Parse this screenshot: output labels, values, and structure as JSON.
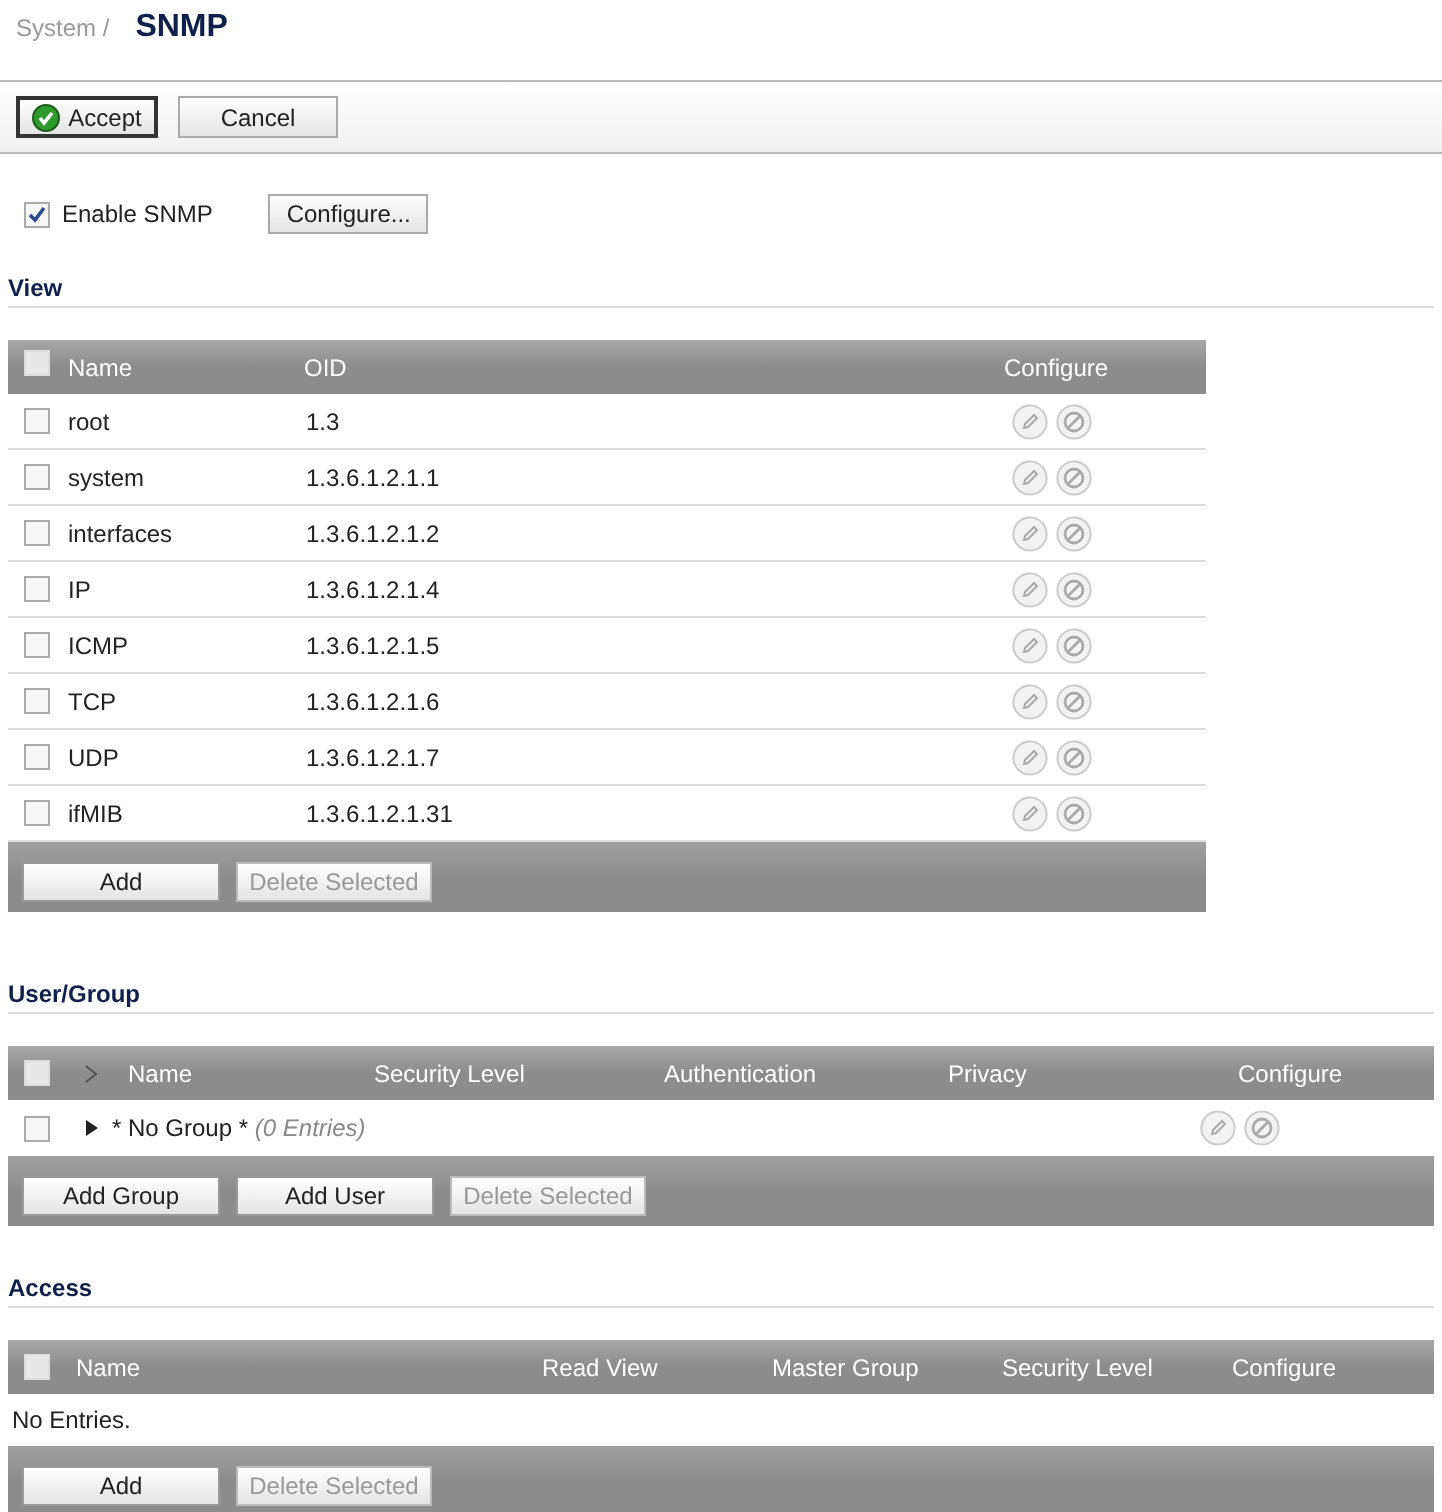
{
  "breadcrumb": "System /",
  "title": "SNMP",
  "toolbar": [
    {
      "label": "Accept",
      "kind": "primary"
    },
    {
      "label": "Cancel",
      "kind": "normal"
    }
  ],
  "enable": {
    "label": "Enable SNMP",
    "checked": true,
    "button": "Configure..."
  },
  "view": {
    "heading": "View",
    "select_all_checked": false,
    "columns": [
      "Name",
      "OID",
      "Configure"
    ],
    "rows": [
      {
        "name": "root",
        "oid": "1.3",
        "checked": false
      },
      {
        "name": "system",
        "oid": "1.3.6.1.2.1.1",
        "checked": false
      },
      {
        "name": "interfaces",
        "oid": "1.3.6.1.2.1.2",
        "checked": false
      },
      {
        "name": "IP",
        "oid": "1.3.6.1.2.1.4",
        "checked": false
      },
      {
        "name": "ICMP",
        "oid": "1.3.6.1.2.1.5",
        "checked": false
      },
      {
        "name": "TCP",
        "oid": "1.3.6.1.2.1.6",
        "checked": false
      },
      {
        "name": "UDP",
        "oid": "1.3.6.1.2.1.7",
        "checked": false
      },
      {
        "name": "ifMIB",
        "oid": "1.3.6.1.2.1.31",
        "checked": false
      }
    ],
    "buttons": [
      {
        "label": "Add",
        "disabled": false
      },
      {
        "label": "Delete Selected",
        "disabled": true
      }
    ]
  },
  "user_group": {
    "heading": "User/Group",
    "select_all_checked": false,
    "columns": [
      "Name",
      "Security Level",
      "Authentication",
      "Privacy",
      "Configure"
    ],
    "rows": [
      {
        "name": "* No Group *",
        "entries": "(0 Entries)",
        "checked": false,
        "expanded": false
      }
    ],
    "buttons": [
      {
        "label": "Add Group",
        "disabled": false
      },
      {
        "label": "Add User",
        "disabled": false
      },
      {
        "label": "Delete Selected",
        "disabled": true
      }
    ]
  },
  "access": {
    "heading": "Access",
    "select_all_checked": false,
    "columns": [
      "Name",
      "Read View",
      "Master Group",
      "Security Level",
      "Configure"
    ],
    "empty_text": "No Entries.",
    "buttons": [
      {
        "label": "Add",
        "disabled": false
      },
      {
        "label": "Delete Selected",
        "disabled": true
      }
    ]
  }
}
